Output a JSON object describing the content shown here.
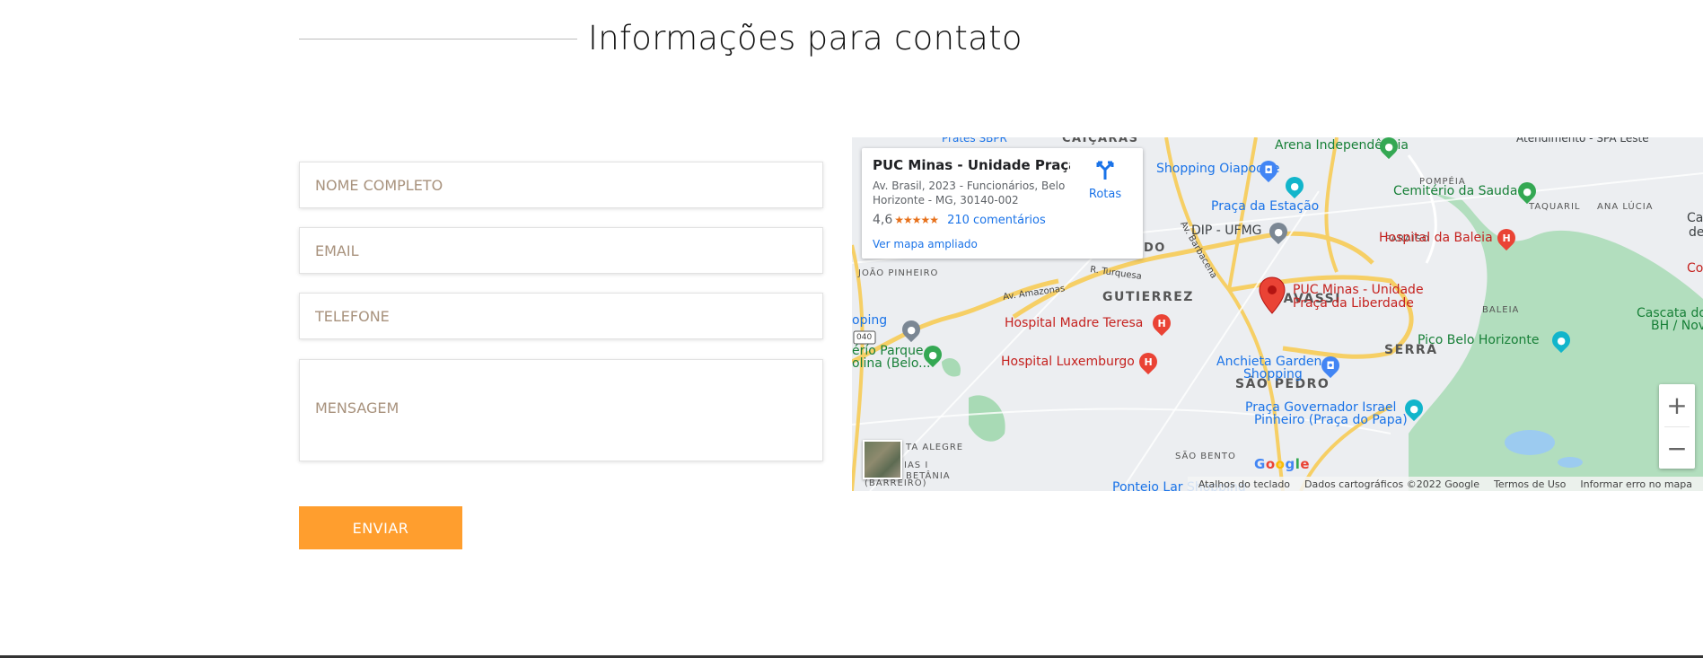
{
  "heading": {
    "title": "Informações para contato"
  },
  "form": {
    "name_placeholder": "NOME COMPLETO",
    "email_placeholder": "EMAIL",
    "phone_placeholder": "TELEFONE",
    "message_placeholder": "MENSAGEM",
    "submit_label": "ENVIAR"
  },
  "map": {
    "card": {
      "title": "PUC Minas - Unidade Praça d...",
      "address": "Av. Brasil, 2023 - Funcionários, Belo Horizonte - MG, 30140-002",
      "rating": "4,6",
      "reviews": "210 comentários",
      "enlarge": "Ver mapa ampliado",
      "directions": "Rotas"
    },
    "marker_label_1": "PUC Minas - Unidade",
    "marker_label_2": "Praça da Liberdade",
    "areas": {
      "caicaras": "CAIÇARAS",
      "gutierrez": "GUTIERREZ",
      "savassi": "SAVASSI",
      "serra": "SERRA",
      "sao_pedro": "SÃO PEDRO",
      "pompeia": "POMPÉIA",
      "taquaril": "TAQUARIL",
      "ana_lucia": "ANA LÚCIA",
      "paraiso": "PARAÍSO",
      "baleia": "BALEIA",
      "joao_pinheiro": "JOÃO PINHEIRO",
      "sao_bento": "SÃO BENTO",
      "santa_alegre": "TA ALEGRE",
      "betania": "BETÂNIA",
      "barreiro": "(BARREIRO)",
      "ias": "IAS I",
      "do": "DO"
    },
    "pois": {
      "arena": "Arena Independência",
      "shopping_oiapoque": "Shopping Oiapoque",
      "cemiterio": "Cemitério da Saudade",
      "praca_estacao": "Praça da Estação",
      "dip_ufmg": "DIP - UFMG",
      "hospital_baleia": "Hospital da Baleia",
      "hospital_madre": "Hospital Madre Teresa",
      "hospital_lux": "Hospital Luxemburgo",
      "pico": "Pico Belo Horizonte",
      "anchieta_1": "Anchieta Garden",
      "anchieta_2": "Shopping",
      "praca_gov_1": "Praça Governador Israel",
      "praca_gov_2": "Pinheiro (Praça do Papa)",
      "parque_1": "érío Parque",
      "parque_2": "olina (Belo...",
      "cascata_1": "Cascata dos T",
      "cascata_2": "BH / Nova",
      "oping": "oping",
      "ponteio": "Ponteio Lar Shopping",
      "frates": "Prates SBPR",
      "atendimento": "Atendimento - SPA Leste",
      "ca": "Ca",
      "de": "de",
      "cobr": "Cobr"
    },
    "roads": {
      "amazonas": "Av. Amazonas",
      "turquesa": "R. Turquesa",
      "barbacena": "Av. Barbacena",
      "br040": "040"
    },
    "zoom_in": "+",
    "zoom_out": "−",
    "attribution": {
      "shortcuts": "Atalhos do teclado",
      "data": "Dados cartográficos ©2022 Google",
      "terms": "Termos de Uso",
      "report": "Informar erro no mapa"
    },
    "google": "Google"
  }
}
